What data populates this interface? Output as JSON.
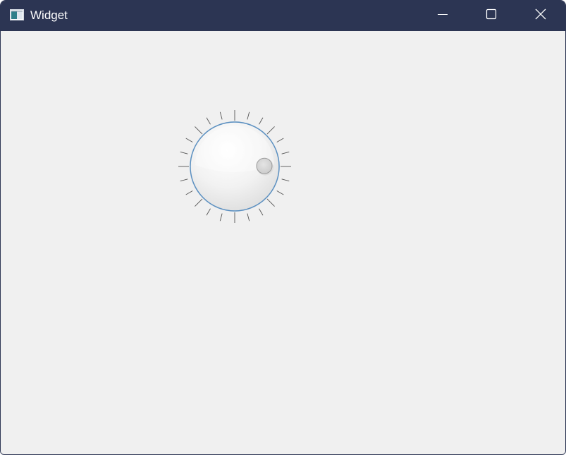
{
  "window": {
    "title": "Widget",
    "app_icon": "qt-widget-app-icon",
    "controls": [
      "minimize-icon",
      "maximize-icon",
      "close-icon"
    ]
  },
  "colors": {
    "titlebar": "#2c3553",
    "client_background": "#f0f0f0",
    "dial_rim": "#5a8fc0"
  },
  "dial": {
    "notches_visible": true,
    "value_fraction": 0.83
  }
}
